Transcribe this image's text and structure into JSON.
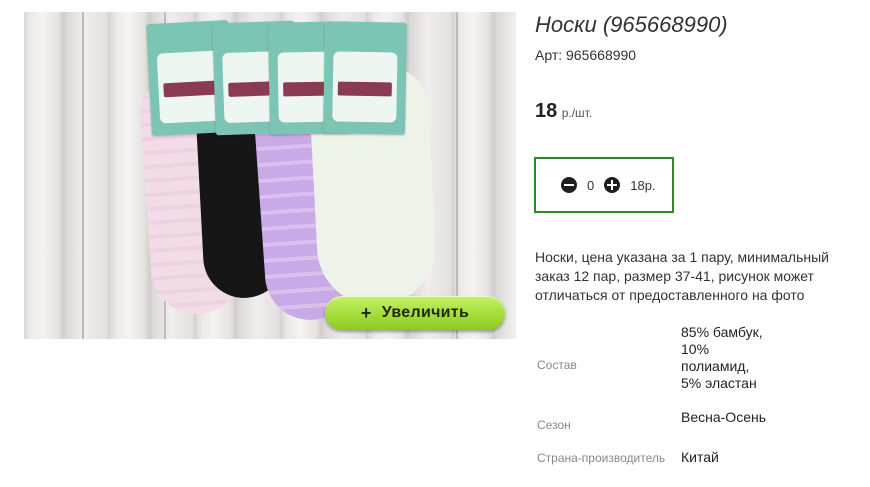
{
  "product": {
    "title": "Носки (965668990)",
    "sku": "Арт: 965668990",
    "price_value": "18",
    "price_unit": "р./шт.",
    "zoom_label": "Увеличить",
    "zoom_plus": "+",
    "description": "Носки, цена указана за 1 пару, минимальный заказ 12 пар, размер 37-41, рисунок может отличаться от предоставленного на фото"
  },
  "quantity": {
    "value": "0",
    "total": "18р."
  },
  "properties": [
    {
      "label": "Состав",
      "value": "85% бамбук, 10% полиамид, 5% эластан"
    },
    {
      "label": "Сезон",
      "value": "Весна-Осень"
    },
    {
      "label": "Страна-производитель",
      "value": "Китай"
    }
  ],
  "colors": {
    "accent_border": "#2e8a22",
    "zoom_button": "#a4dd3a"
  }
}
